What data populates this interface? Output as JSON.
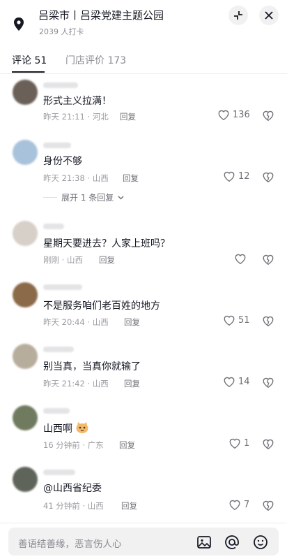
{
  "header": {
    "title": "吕梁市丨吕梁党建主题公园",
    "subtitle": "2039 人打卡"
  },
  "tabs": [
    {
      "label": "评论 51",
      "active": true
    },
    {
      "label": "门店评价 173",
      "active": false
    }
  ],
  "reply_label": "回复",
  "comments": [
    {
      "text": "形式主义拉满！",
      "time": "昨天 21:11 · 河北",
      "likes": "136"
    },
    {
      "text": "身份不够",
      "time": "昨天 21:38 · 山西",
      "likes": "12",
      "expand": "展开 1 条回复"
    },
    {
      "text": "星期天要进去？人家上班吗？",
      "time": "刚刚 · 山西",
      "likes": ""
    },
    {
      "text": "不是服务咱们老百姓的地方",
      "time": "昨天 20:44 · 山西",
      "likes": "51"
    },
    {
      "text": "别当真，当真你就输了",
      "time": "昨天 21:42 · 山西",
      "likes": "14"
    },
    {
      "text": "山西啊",
      "time": "16 分钟前 · 广东",
      "likes": "1",
      "emoji": "cat-emoji"
    },
    {
      "text": "@山西省纪委",
      "time": "41 分钟前 · 山西",
      "likes": "7"
    }
  ],
  "footer": {
    "placeholder": "善语结善缘，恶言伤人心"
  },
  "icons": {
    "location": "location-pin-icon",
    "minimize": "minimize-icon",
    "close": "close-icon",
    "like": "heart-icon",
    "dislike": "broken-heart-icon",
    "image": "image-icon",
    "mention": "at-icon",
    "emoji": "emoji-icon"
  }
}
